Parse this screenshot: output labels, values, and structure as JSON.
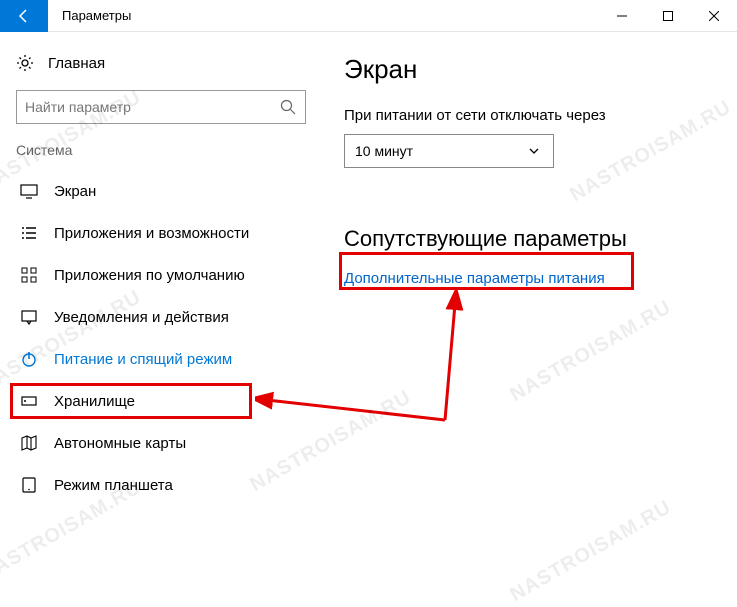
{
  "window": {
    "title": "Параметры"
  },
  "sidebar": {
    "home_label": "Главная",
    "search_placeholder": "Найти параметр",
    "category": "Система",
    "items": [
      {
        "label": "Экран"
      },
      {
        "label": "Приложения и возможности"
      },
      {
        "label": "Приложения по умолчанию"
      },
      {
        "label": "Уведомления и действия"
      },
      {
        "label": "Питание и спящий режим"
      },
      {
        "label": "Хранилище"
      },
      {
        "label": "Автономные карты"
      },
      {
        "label": "Режим планшета"
      }
    ]
  },
  "main": {
    "heading": "Экран",
    "plugged_label": "При питании от сети отключать через",
    "plugged_value": "10 минут",
    "related_heading": "Сопутствующие параметры",
    "related_link": "Дополнительные параметры питания"
  },
  "watermark": "NASTROISAM.RU"
}
